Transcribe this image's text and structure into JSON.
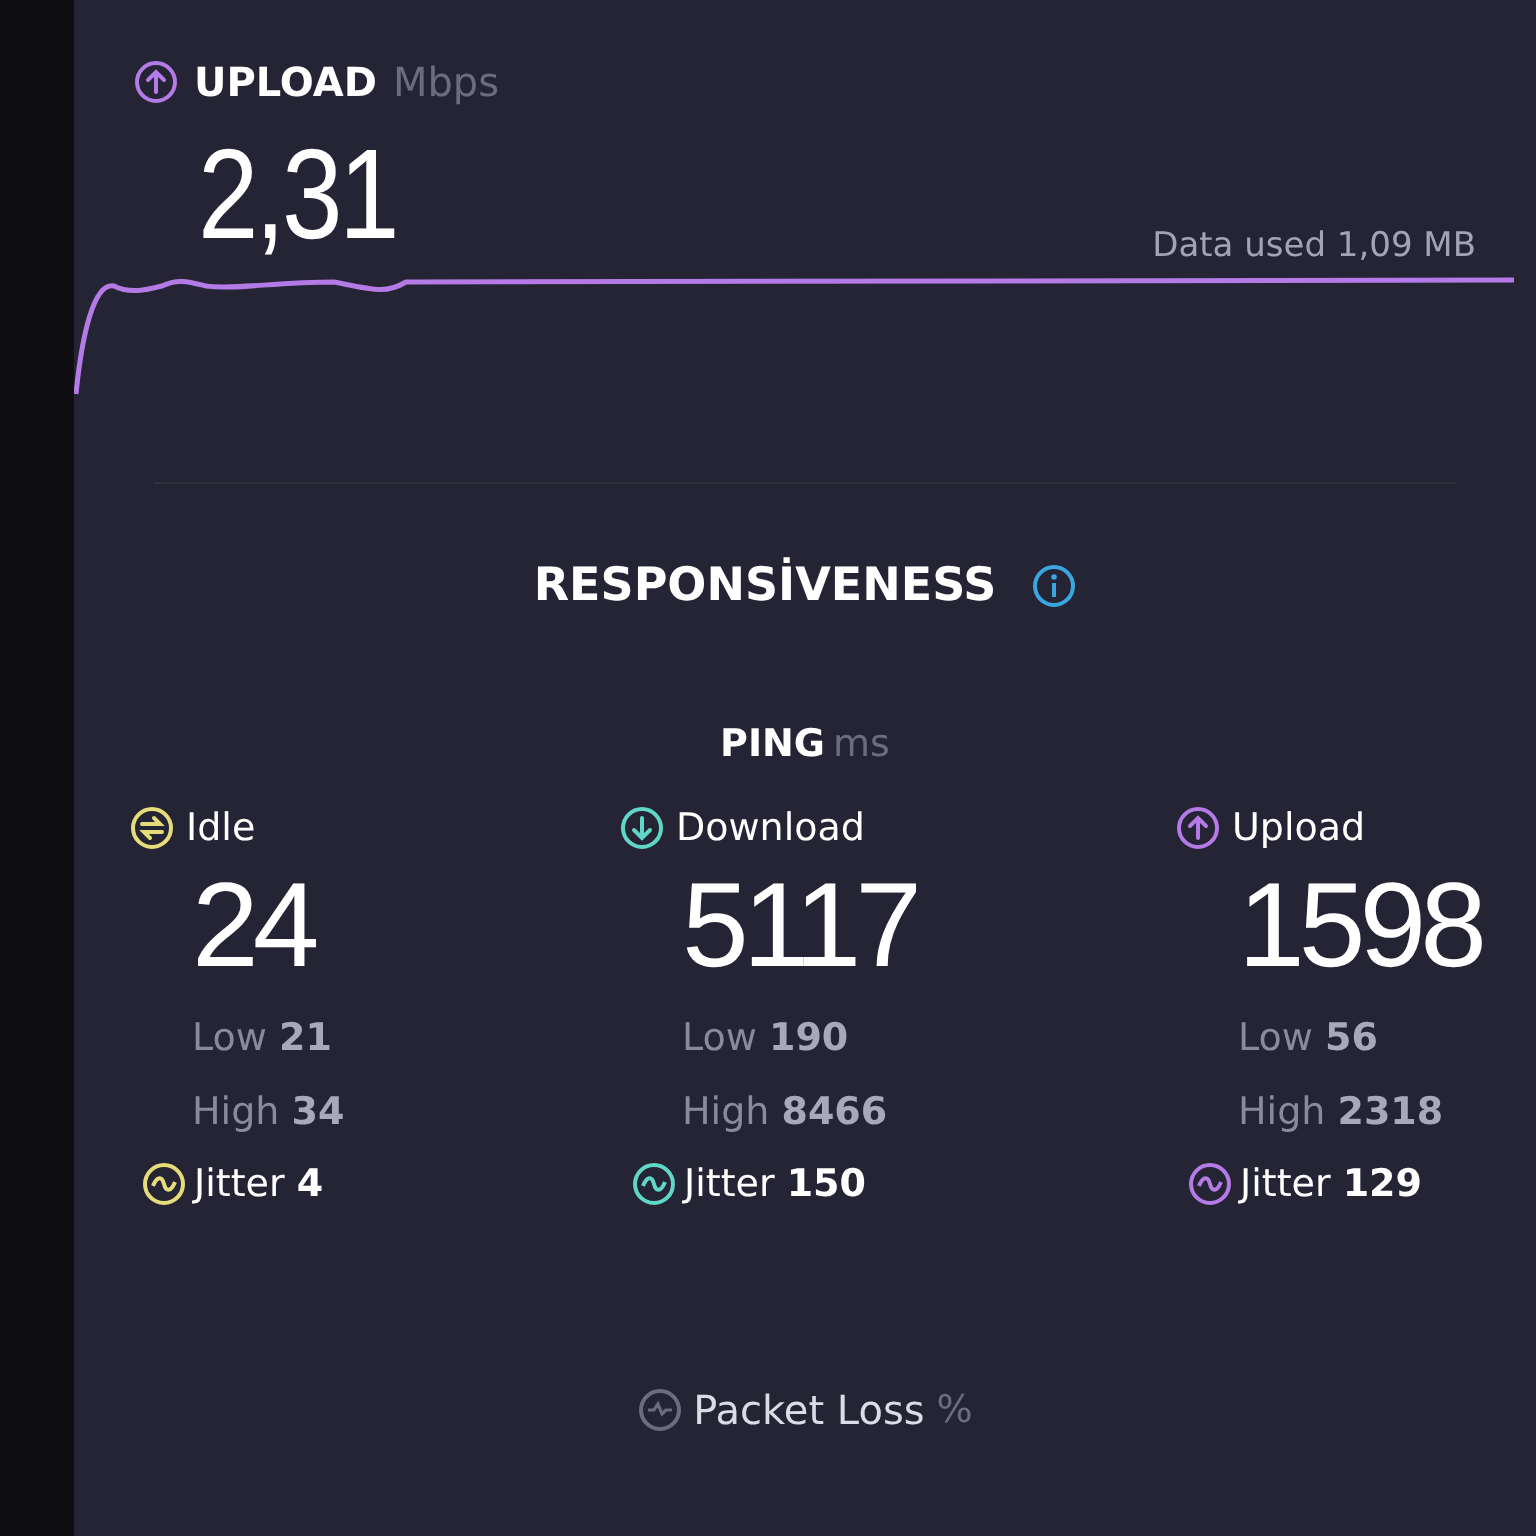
{
  "upload": {
    "label": "UPLOAD",
    "unit": "Mbps",
    "value": "2,31",
    "data_used": "Data used 1,09 MB"
  },
  "responsiveness": {
    "title": "RESPONSİVENESS",
    "ping_label": "PING",
    "ping_unit": "ms",
    "columns": [
      {
        "kind": "idle",
        "color": "#e6dc7a",
        "label": "Idle",
        "value": "24",
        "low_label": "Low",
        "low": "21",
        "high_label": "High",
        "high": "34",
        "jitter_label": "Jitter",
        "jitter": "4"
      },
      {
        "kind": "download",
        "color": "#5fd6c6",
        "label": "Download",
        "value": "5117",
        "low_label": "Low",
        "low": "190",
        "high_label": "High",
        "high": "8466",
        "jitter_label": "Jitter",
        "jitter": "150"
      },
      {
        "kind": "upload",
        "color": "#b47ae6",
        "label": "Upload",
        "value": "1598",
        "low_label": "Low",
        "low": "56",
        "high_label": "High",
        "high": "2318",
        "jitter_label": "Jitter",
        "jitter": "129"
      }
    ],
    "packet_loss": {
      "label": "Packet Loss",
      "unit": "%"
    }
  }
}
